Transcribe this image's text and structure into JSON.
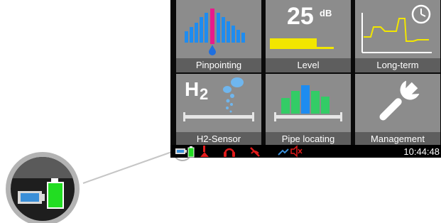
{
  "tiles": [
    {
      "id": "pinpointing",
      "label": "Pinpointing",
      "icon": "pinpointing-bars-icon"
    },
    {
      "id": "level",
      "label": "Level",
      "icon": "level-meter-icon",
      "value": "25",
      "unit": "dB"
    },
    {
      "id": "long-term",
      "label": "Long-term",
      "icon": "long-term-clock-graph-icon"
    },
    {
      "id": "h2-sensor",
      "label": "H2-Sensor",
      "icon": "h2-bubbles-icon",
      "formula_main": "H",
      "formula_sub": "2"
    },
    {
      "id": "pipe-locating",
      "label": "Pipe locating",
      "icon": "pipe-locating-bars-icon"
    },
    {
      "id": "management",
      "label": "Management",
      "icon": "wrench-icon"
    }
  ],
  "status_bar": {
    "time": "10:44:48",
    "icons": [
      "battery-device-icon",
      "battery-green-icon",
      "red-probe-icon",
      "red-headphones-icon",
      "red-crossed-icon",
      "blue-signal-icon",
      "speaker-muted-icon"
    ]
  },
  "colors": {
    "tile_bg": "#8c8c8c",
    "tile_label_bg": "#5e5e5e",
    "accent_magenta": "#e81a8c",
    "accent_blue": "#1e8cf0",
    "accent_yellow": "#f2e600",
    "accent_green": "#33cc66",
    "battery_green": "#22dd22",
    "status_red": "#e21b1b"
  }
}
